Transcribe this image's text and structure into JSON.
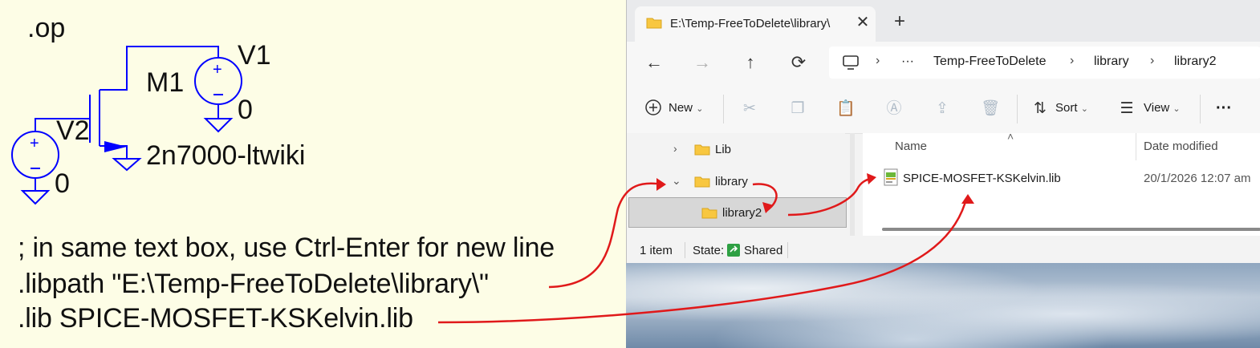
{
  "schematic": {
    "directive_op": ".op",
    "m1_label": "M1",
    "v1_label": "V1",
    "v2_label": "V2",
    "gnd_v1": "0",
    "gnd_v2": "0",
    "model_name": "2n7000-ltwiki",
    "spice_lines": [
      "; in same text box, use Ctrl-Enter for new line",
      ".libpath \"E:\\Temp-FreeToDelete\\library\\\"",
      ".lib SPICE-MOSFET-KSKelvin.lib"
    ],
    "wire_color": "#0000ff",
    "arrow_color": "#e0191a"
  },
  "explorer": {
    "tab_title": "E:\\Temp-FreeToDelete\\library\\",
    "tab_close": "✕",
    "new_tab": "+",
    "nav": {
      "back": "←",
      "forward": "→",
      "up": "↑",
      "refresh": "⟳"
    },
    "breadcrumb": {
      "ellipsis": "···",
      "items": [
        "Temp-FreeToDelete",
        "library",
        "library2"
      ]
    },
    "commands": {
      "new": "New",
      "sort": "Sort",
      "view": "View",
      "more": "···"
    },
    "tree": [
      {
        "label": "Lib",
        "expanded": false
      },
      {
        "label": "library",
        "expanded": true
      },
      {
        "label": "library2",
        "selected": true
      }
    ],
    "columns": {
      "name": "Name",
      "date": "Date modified"
    },
    "files": [
      {
        "name": "SPICE-MOSFET-KSKelvin.lib",
        "date": "20/1/2026 12:07 am"
      }
    ],
    "status": {
      "count": "1 item",
      "state": "State:",
      "shared": "Shared"
    },
    "accent": "#0067c0",
    "folder_color": "#f8c740"
  }
}
